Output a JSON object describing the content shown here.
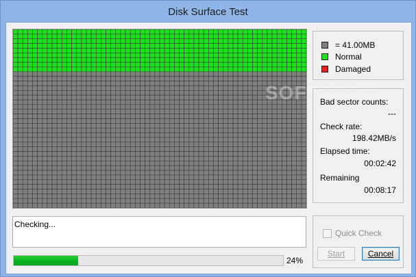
{
  "window": {
    "title": "Disk Surface Test"
  },
  "grid": {
    "cols": 60,
    "rows": 38,
    "normal_rows": 9,
    "colors": {
      "normal": "#1ee11e",
      "unchecked": "#808080",
      "line": "#3a3a3a"
    }
  },
  "legend": {
    "items": [
      {
        "icon": "grey-square-icon",
        "label": "= 41.00MB",
        "color": "#808080"
      },
      {
        "icon": "green-square-icon",
        "label": "Normal",
        "color": "#1ee11e"
      },
      {
        "icon": "red-square-icon",
        "label": "Damaged",
        "color": "#e41d1d"
      }
    ]
  },
  "stats": {
    "bad_sector_label": "Bad sector counts:",
    "bad_sector_value": "---",
    "check_rate_label": "Check rate:",
    "check_rate_value": "198.42MB/s",
    "elapsed_label": "Elapsed time:",
    "elapsed_value": "00:02:42",
    "remaining_label": "Remaining",
    "remaining_value": "00:08:17"
  },
  "status": {
    "text": "Checking..."
  },
  "progress": {
    "percent_label": "24%",
    "fraction": 0.24,
    "color": "#06b025"
  },
  "actions": {
    "quick_check_label": "Quick Check",
    "quick_check_checked": false,
    "start_label": "Start",
    "cancel_label": "Cancel"
  },
  "watermark": "SOFTPEDIA"
}
